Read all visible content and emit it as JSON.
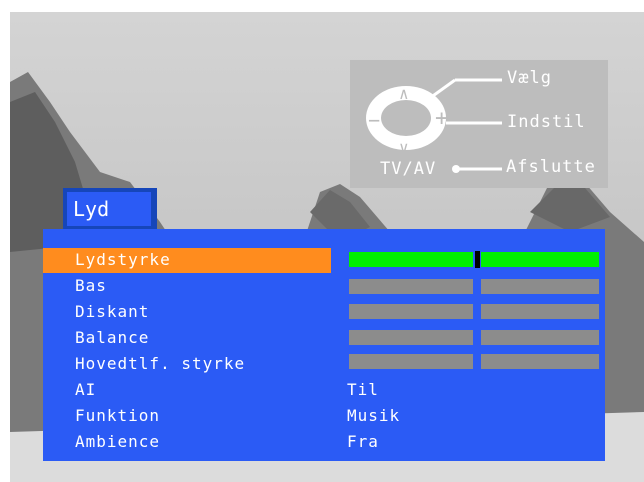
{
  "help": {
    "select": "Vælg",
    "adjust": "Indstil",
    "exit": "Afslutte",
    "tvav": "TV/AV",
    "minus": "−",
    "plus": "+",
    "up": "∧",
    "down": "∨"
  },
  "menu": {
    "title": "Lyd",
    "items": [
      {
        "label": "Lydstyrke",
        "level": 0.5
      },
      {
        "label": "Bas"
      },
      {
        "label": "Diskant"
      },
      {
        "label": "Balance"
      },
      {
        "label": "Hovedtlf. styrke"
      },
      {
        "label": "AI",
        "value": "Til"
      },
      {
        "label": "Funktion",
        "value": "Musik"
      },
      {
        "label": "Ambience",
        "value": "Fra"
      }
    ]
  },
  "colors": {
    "menu_bg": "#2b5bf5",
    "highlight": "#ff8c1e",
    "level_bar": "#00f000",
    "inactive_bar": "#8c8c8c"
  }
}
